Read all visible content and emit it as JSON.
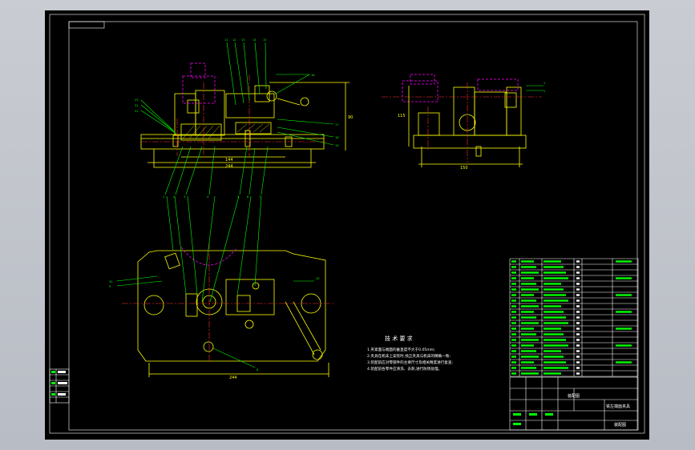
{
  "tech_requirements": {
    "title": "技 术 要 求",
    "items": [
      "1.夹紧面与端面的垂直度不大于0.05mm;",
      "2.夹具在机床上安装时,找正夹具与机床的精确一致;",
      "3.装配前应对零部件的主要尺寸及相关精度进行复查;",
      "4.装配前各零件应清洗、去刺,进行防锈处理。"
    ]
  },
  "dimensions": {
    "front_width": "244",
    "front_inner": "144",
    "front_height": "90",
    "side_width": "150",
    "side_height": "115",
    "plan_width": "244"
  },
  "title_block": {
    "drawing_name": "铣左端面夹具",
    "label_1": "装配图",
    "label_2": "装配图"
  },
  "colors": {
    "background": "#000000",
    "outline": "#ffff00",
    "leader": "#00ff00",
    "centerline": "#ff3030",
    "hidden": "#ff00ff",
    "border": "#ffffff"
  }
}
